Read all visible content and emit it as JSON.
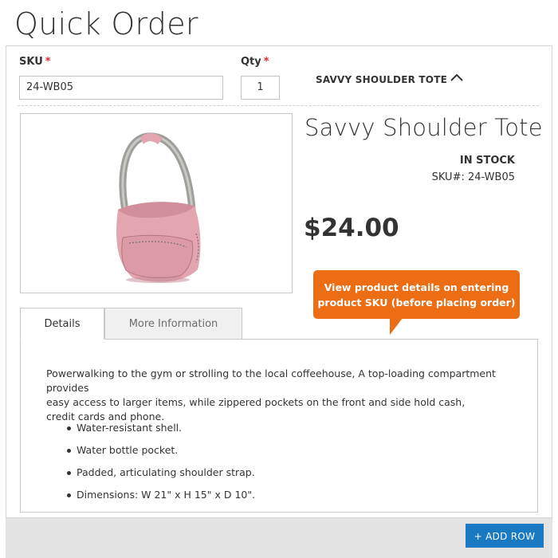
{
  "page": {
    "title": "Quick Order"
  },
  "form": {
    "sku_label": "SKU",
    "sku_required": "*",
    "sku_value": "24-WB05",
    "qty_label": "Qty",
    "qty_required": "*",
    "qty_value": "1",
    "product_name_header": "SAVVY SHOULDER TOTE",
    "collapse_icon": "chevron-up-icon"
  },
  "product": {
    "name": "Savvy Shoulder Tote",
    "stock": "IN STOCK",
    "sku_line": "SKU#: 24-WB05",
    "price": "$24.00",
    "image": "pink-shoulder-tote-bag",
    "colors": {
      "bag": "#e3a6b0",
      "strap": "#9d9f9a"
    }
  },
  "tooltip": {
    "line1": "View product details on entering",
    "line2": "product SKU (before placing order)",
    "color": "#ec6d13"
  },
  "tabs": [
    {
      "label": "Details",
      "active": true
    },
    {
      "label": "More Information",
      "active": false
    }
  ],
  "details": {
    "description": [
      "Powerwalking to the gym or strolling to the local coffeehouse, A top-loading compartment provides",
      "easy access to larger items, while zippered pockets on the front and side hold cash,",
      "credit cards and phone."
    ],
    "features": [
      "Water-resistant shell.",
      "Water bottle pocket.",
      "Padded, articulating shoulder strap.",
      "Dimensions: W 21\" x H 15\" x D 10\"."
    ]
  },
  "footer": {
    "add_row_label": "+ ADD ROW",
    "button_color": "#1979c3"
  }
}
